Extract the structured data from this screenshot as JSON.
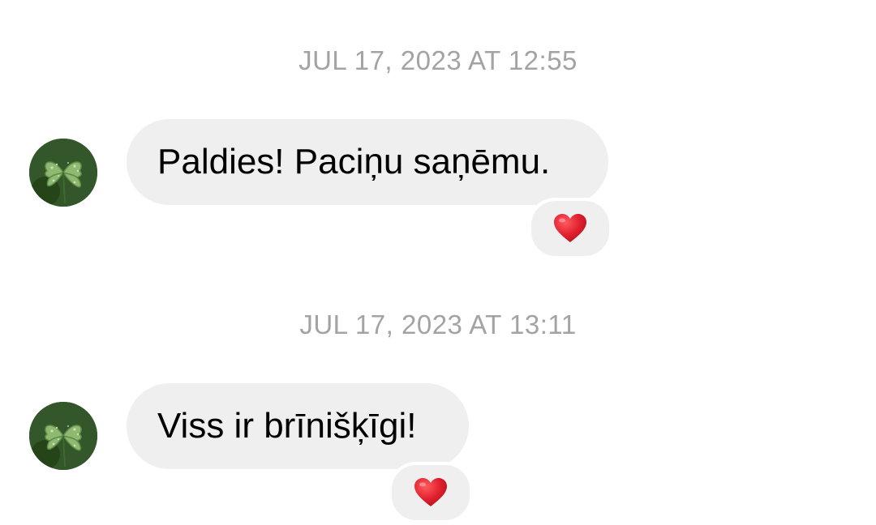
{
  "messages": [
    {
      "timestamp": "JUL 17, 2023 AT 12:55",
      "text": "Paldies! Paciņu saņēmu.",
      "reaction": "heart-emoji"
    },
    {
      "timestamp": "JUL 17, 2023 AT 13:11",
      "text": "Viss ir brīnišķīgi!",
      "reaction": "heart-emoji"
    }
  ],
  "colors": {
    "bubble_bg": "#efefef",
    "timestamp_text": "#a3a3a3",
    "heart": "#e0202e",
    "avatar_green": "#4f7a3a"
  },
  "avatar": {
    "icon": "four-leaf-clover"
  }
}
